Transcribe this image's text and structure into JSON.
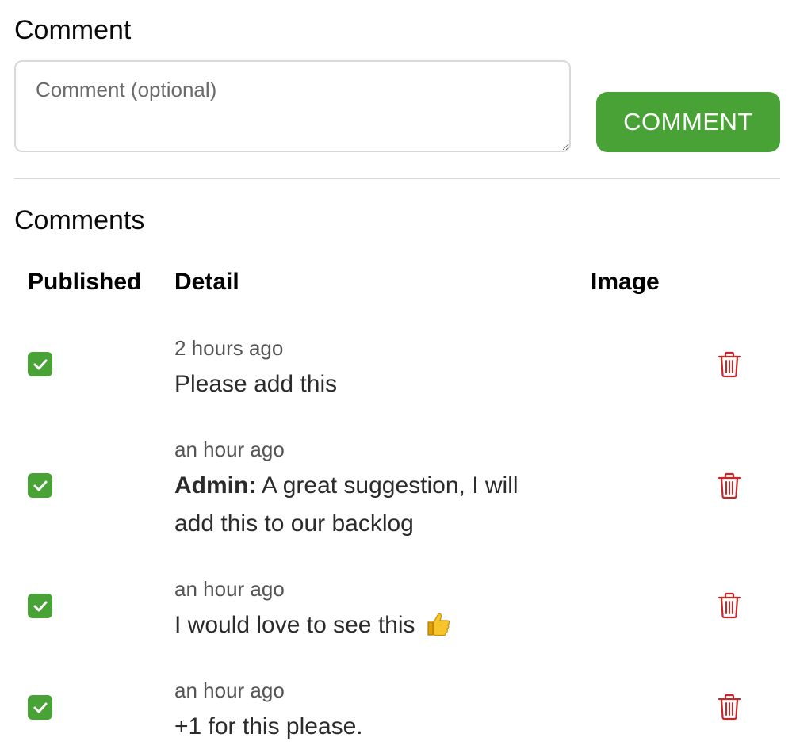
{
  "composer": {
    "heading": "Comment",
    "placeholder": "Comment (optional)",
    "value": "",
    "button_label": "COMMENT"
  },
  "comments_section": {
    "heading": "Comments",
    "columns": [
      "Published",
      "Detail",
      "Image"
    ],
    "rows": [
      {
        "published": true,
        "time": "2 hours ago",
        "author": "",
        "text": "Please add this",
        "emoji": ""
      },
      {
        "published": true,
        "time": "an hour ago",
        "author": "Admin:",
        "text": "A great suggestion, I will add this to our backlog",
        "emoji": ""
      },
      {
        "published": true,
        "time": "an hour ago",
        "author": "",
        "text": "I would love to see this",
        "emoji": "thumbs-up"
      },
      {
        "published": true,
        "time": "an hour ago",
        "author": "",
        "text": "+1 for this please.",
        "emoji": ""
      }
    ]
  },
  "colors": {
    "accent": "#48a235",
    "delete": "#c62828",
    "muted_text": "#555555"
  },
  "icons": {
    "checkbox": "check-icon",
    "delete": "trash-icon",
    "emoji": "thumbs-up-icon"
  }
}
